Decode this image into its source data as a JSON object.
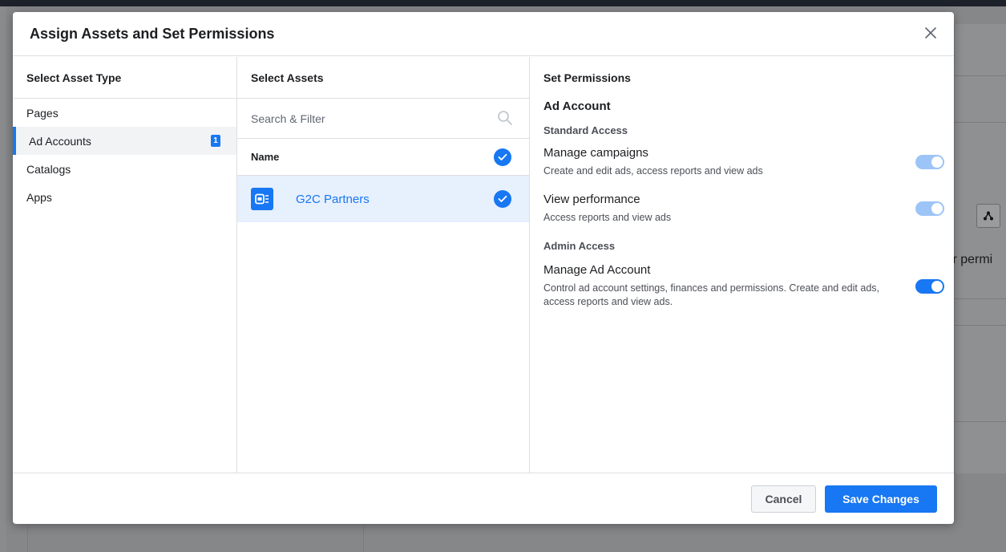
{
  "modal": {
    "title": "Assign Assets and Set Permissions"
  },
  "background": {
    "partial_text": "eir permi"
  },
  "asset_types": {
    "heading": "Select Asset Type",
    "items": [
      {
        "label": "Pages"
      },
      {
        "label": "Ad Accounts",
        "badge": "1"
      },
      {
        "label": "Catalogs"
      },
      {
        "label": "Apps"
      }
    ],
    "selected": "Ad Accounts"
  },
  "assets": {
    "heading": "Select Assets",
    "search_placeholder": "Search & Filter",
    "name_header": "Name",
    "select_all_checked": true,
    "items": [
      {
        "name": "G2C Partners",
        "checked": true
      }
    ]
  },
  "permissions": {
    "heading": "Set Permissions",
    "asset_label": "Ad Account",
    "standard_section": "Standard Access",
    "admin_section": "Admin Access",
    "items": [
      {
        "name": "Manage campaigns",
        "description": "Create and edit ads, access reports and view ads",
        "enabled": true,
        "locked": true
      },
      {
        "name": "View performance",
        "description": "Access reports and view ads",
        "enabled": true,
        "locked": true
      },
      {
        "name": "Manage Ad Account",
        "description": "Control ad account settings, finances and permissions. Create and edit ads, access reports and view ads.",
        "enabled": true,
        "locked": false
      }
    ]
  },
  "footer": {
    "cancel_label": "Cancel",
    "save_label": "Save Changes"
  },
  "colors": {
    "accent": "#1877f2",
    "accent_light": "#9cc4f7",
    "selected_row": "#e7f0fd"
  }
}
